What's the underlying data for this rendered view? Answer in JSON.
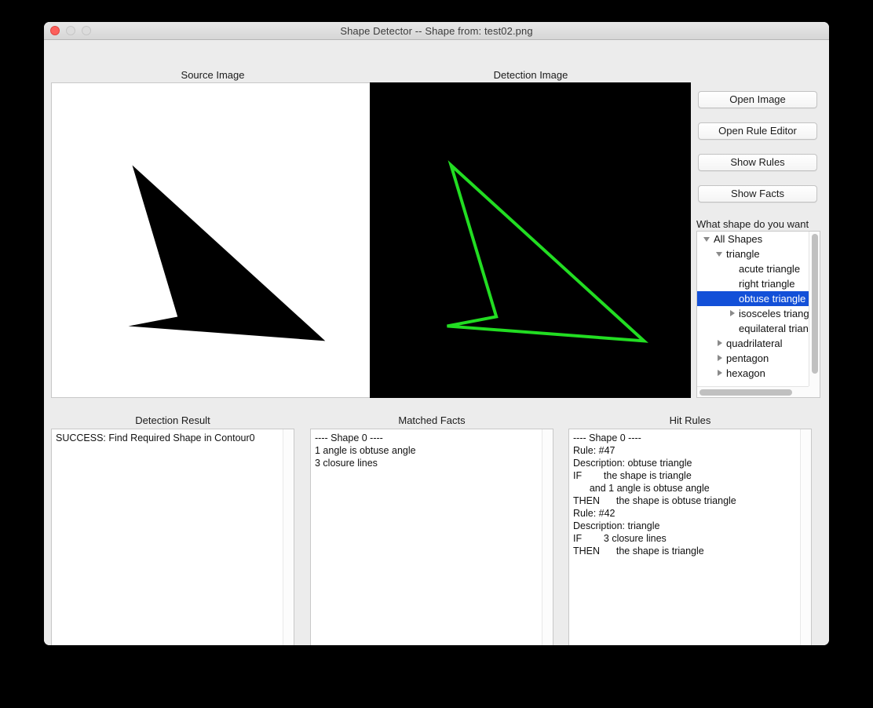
{
  "window": {
    "title": "Shape Detector -- Shape from: test02.png",
    "traffic_lights": [
      "close-button",
      "minimize-button",
      "maximize-button"
    ]
  },
  "panels": {
    "source_label": "Source Image",
    "detection_label": "Detection Image",
    "result_label": "Detection Result",
    "facts_label": "Matched Facts",
    "rules_label": "Hit Rules"
  },
  "buttons": {
    "open_image": "Open Image",
    "open_rule_editor": "Open Rule Editor",
    "show_rules": "Show Rules",
    "show_facts": "Show Facts"
  },
  "tree": {
    "prompt": "What shape do you want",
    "items": [
      {
        "label": "All Shapes",
        "indent": 0,
        "state": "expanded",
        "selected": false
      },
      {
        "label": "triangle",
        "indent": 1,
        "state": "expanded",
        "selected": false
      },
      {
        "label": "acute triangle",
        "indent": 2,
        "state": "leaf",
        "selected": false
      },
      {
        "label": "right triangle",
        "indent": 2,
        "state": "leaf",
        "selected": false
      },
      {
        "label": "obtuse triangle",
        "indent": 2,
        "state": "leaf",
        "selected": true
      },
      {
        "label": "isosceles triangle",
        "indent": 2,
        "state": "collapsed",
        "selected": false
      },
      {
        "label": "equilateral triangle",
        "indent": 2,
        "state": "leaf",
        "selected": false
      },
      {
        "label": "quadrilateral",
        "indent": 1,
        "state": "collapsed",
        "selected": false
      },
      {
        "label": "pentagon",
        "indent": 1,
        "state": "collapsed",
        "selected": false
      },
      {
        "label": "hexagon",
        "indent": 1,
        "state": "collapsed",
        "selected": false
      }
    ],
    "selection_color": "#1350d8"
  },
  "output": {
    "detection_result": "SUCCESS: Find Required Shape in Contour0",
    "matched_facts": "---- Shape 0 ----\n1 angle is obtuse angle\n3 closure lines",
    "hit_rules": "---- Shape 0 ----\nRule: #47\nDescription: obtuse triangle\nIF        the shape is triangle\n      and 1 angle is obtuse angle\nTHEN      the shape is obtuse triangle\nRule: #42\nDescription: triangle\nIF        3 closure lines\nTHEN      the shape is triangle"
  },
  "graphics": {
    "source_shape_color": "#000000",
    "source_background": "#ffffff",
    "detection_shape_color": "#22dd22",
    "detection_background": "#000000",
    "shape_points": "103,105 161,299 98,311 350,330"
  }
}
